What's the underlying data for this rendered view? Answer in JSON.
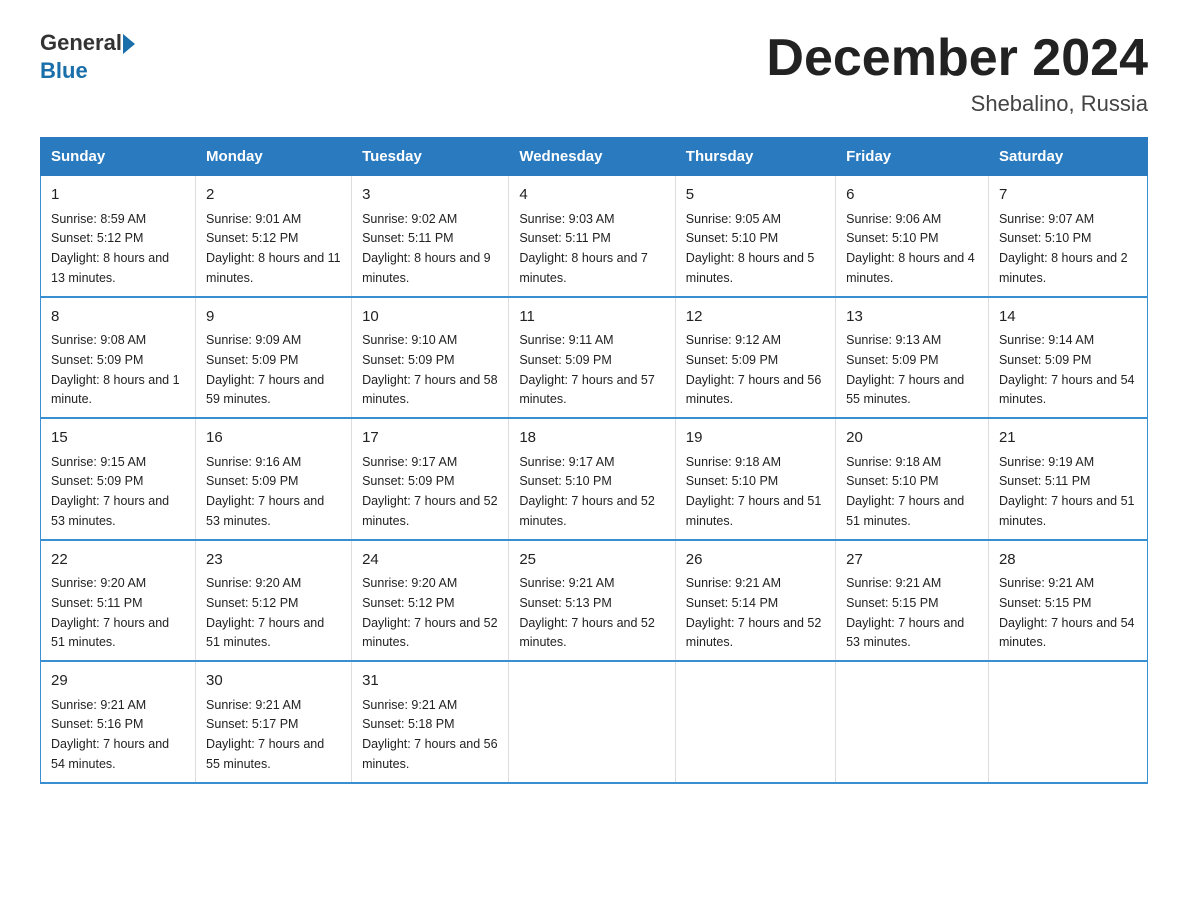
{
  "header": {
    "logo_general": "General",
    "logo_blue": "Blue",
    "title": "December 2024",
    "subtitle": "Shebalino, Russia"
  },
  "days_of_week": [
    "Sunday",
    "Monday",
    "Tuesday",
    "Wednesday",
    "Thursday",
    "Friday",
    "Saturday"
  ],
  "weeks": [
    [
      {
        "day": "1",
        "sunrise": "Sunrise: 8:59 AM",
        "sunset": "Sunset: 5:12 PM",
        "daylight": "Daylight: 8 hours and 13 minutes."
      },
      {
        "day": "2",
        "sunrise": "Sunrise: 9:01 AM",
        "sunset": "Sunset: 5:12 PM",
        "daylight": "Daylight: 8 hours and 11 minutes."
      },
      {
        "day": "3",
        "sunrise": "Sunrise: 9:02 AM",
        "sunset": "Sunset: 5:11 PM",
        "daylight": "Daylight: 8 hours and 9 minutes."
      },
      {
        "day": "4",
        "sunrise": "Sunrise: 9:03 AM",
        "sunset": "Sunset: 5:11 PM",
        "daylight": "Daylight: 8 hours and 7 minutes."
      },
      {
        "day": "5",
        "sunrise": "Sunrise: 9:05 AM",
        "sunset": "Sunset: 5:10 PM",
        "daylight": "Daylight: 8 hours and 5 minutes."
      },
      {
        "day": "6",
        "sunrise": "Sunrise: 9:06 AM",
        "sunset": "Sunset: 5:10 PM",
        "daylight": "Daylight: 8 hours and 4 minutes."
      },
      {
        "day": "7",
        "sunrise": "Sunrise: 9:07 AM",
        "sunset": "Sunset: 5:10 PM",
        "daylight": "Daylight: 8 hours and 2 minutes."
      }
    ],
    [
      {
        "day": "8",
        "sunrise": "Sunrise: 9:08 AM",
        "sunset": "Sunset: 5:09 PM",
        "daylight": "Daylight: 8 hours and 1 minute."
      },
      {
        "day": "9",
        "sunrise": "Sunrise: 9:09 AM",
        "sunset": "Sunset: 5:09 PM",
        "daylight": "Daylight: 7 hours and 59 minutes."
      },
      {
        "day": "10",
        "sunrise": "Sunrise: 9:10 AM",
        "sunset": "Sunset: 5:09 PM",
        "daylight": "Daylight: 7 hours and 58 minutes."
      },
      {
        "day": "11",
        "sunrise": "Sunrise: 9:11 AM",
        "sunset": "Sunset: 5:09 PM",
        "daylight": "Daylight: 7 hours and 57 minutes."
      },
      {
        "day": "12",
        "sunrise": "Sunrise: 9:12 AM",
        "sunset": "Sunset: 5:09 PM",
        "daylight": "Daylight: 7 hours and 56 minutes."
      },
      {
        "day": "13",
        "sunrise": "Sunrise: 9:13 AM",
        "sunset": "Sunset: 5:09 PM",
        "daylight": "Daylight: 7 hours and 55 minutes."
      },
      {
        "day": "14",
        "sunrise": "Sunrise: 9:14 AM",
        "sunset": "Sunset: 5:09 PM",
        "daylight": "Daylight: 7 hours and 54 minutes."
      }
    ],
    [
      {
        "day": "15",
        "sunrise": "Sunrise: 9:15 AM",
        "sunset": "Sunset: 5:09 PM",
        "daylight": "Daylight: 7 hours and 53 minutes."
      },
      {
        "day": "16",
        "sunrise": "Sunrise: 9:16 AM",
        "sunset": "Sunset: 5:09 PM",
        "daylight": "Daylight: 7 hours and 53 minutes."
      },
      {
        "day": "17",
        "sunrise": "Sunrise: 9:17 AM",
        "sunset": "Sunset: 5:09 PM",
        "daylight": "Daylight: 7 hours and 52 minutes."
      },
      {
        "day": "18",
        "sunrise": "Sunrise: 9:17 AM",
        "sunset": "Sunset: 5:10 PM",
        "daylight": "Daylight: 7 hours and 52 minutes."
      },
      {
        "day": "19",
        "sunrise": "Sunrise: 9:18 AM",
        "sunset": "Sunset: 5:10 PM",
        "daylight": "Daylight: 7 hours and 51 minutes."
      },
      {
        "day": "20",
        "sunrise": "Sunrise: 9:18 AM",
        "sunset": "Sunset: 5:10 PM",
        "daylight": "Daylight: 7 hours and 51 minutes."
      },
      {
        "day": "21",
        "sunrise": "Sunrise: 9:19 AM",
        "sunset": "Sunset: 5:11 PM",
        "daylight": "Daylight: 7 hours and 51 minutes."
      }
    ],
    [
      {
        "day": "22",
        "sunrise": "Sunrise: 9:20 AM",
        "sunset": "Sunset: 5:11 PM",
        "daylight": "Daylight: 7 hours and 51 minutes."
      },
      {
        "day": "23",
        "sunrise": "Sunrise: 9:20 AM",
        "sunset": "Sunset: 5:12 PM",
        "daylight": "Daylight: 7 hours and 51 minutes."
      },
      {
        "day": "24",
        "sunrise": "Sunrise: 9:20 AM",
        "sunset": "Sunset: 5:12 PM",
        "daylight": "Daylight: 7 hours and 52 minutes."
      },
      {
        "day": "25",
        "sunrise": "Sunrise: 9:21 AM",
        "sunset": "Sunset: 5:13 PM",
        "daylight": "Daylight: 7 hours and 52 minutes."
      },
      {
        "day": "26",
        "sunrise": "Sunrise: 9:21 AM",
        "sunset": "Sunset: 5:14 PM",
        "daylight": "Daylight: 7 hours and 52 minutes."
      },
      {
        "day": "27",
        "sunrise": "Sunrise: 9:21 AM",
        "sunset": "Sunset: 5:15 PM",
        "daylight": "Daylight: 7 hours and 53 minutes."
      },
      {
        "day": "28",
        "sunrise": "Sunrise: 9:21 AM",
        "sunset": "Sunset: 5:15 PM",
        "daylight": "Daylight: 7 hours and 54 minutes."
      }
    ],
    [
      {
        "day": "29",
        "sunrise": "Sunrise: 9:21 AM",
        "sunset": "Sunset: 5:16 PM",
        "daylight": "Daylight: 7 hours and 54 minutes."
      },
      {
        "day": "30",
        "sunrise": "Sunrise: 9:21 AM",
        "sunset": "Sunset: 5:17 PM",
        "daylight": "Daylight: 7 hours and 55 minutes."
      },
      {
        "day": "31",
        "sunrise": "Sunrise: 9:21 AM",
        "sunset": "Sunset: 5:18 PM",
        "daylight": "Daylight: 7 hours and 56 minutes."
      },
      {
        "day": "",
        "sunrise": "",
        "sunset": "",
        "daylight": ""
      },
      {
        "day": "",
        "sunrise": "",
        "sunset": "",
        "daylight": ""
      },
      {
        "day": "",
        "sunrise": "",
        "sunset": "",
        "daylight": ""
      },
      {
        "day": "",
        "sunrise": "",
        "sunset": "",
        "daylight": ""
      }
    ]
  ]
}
